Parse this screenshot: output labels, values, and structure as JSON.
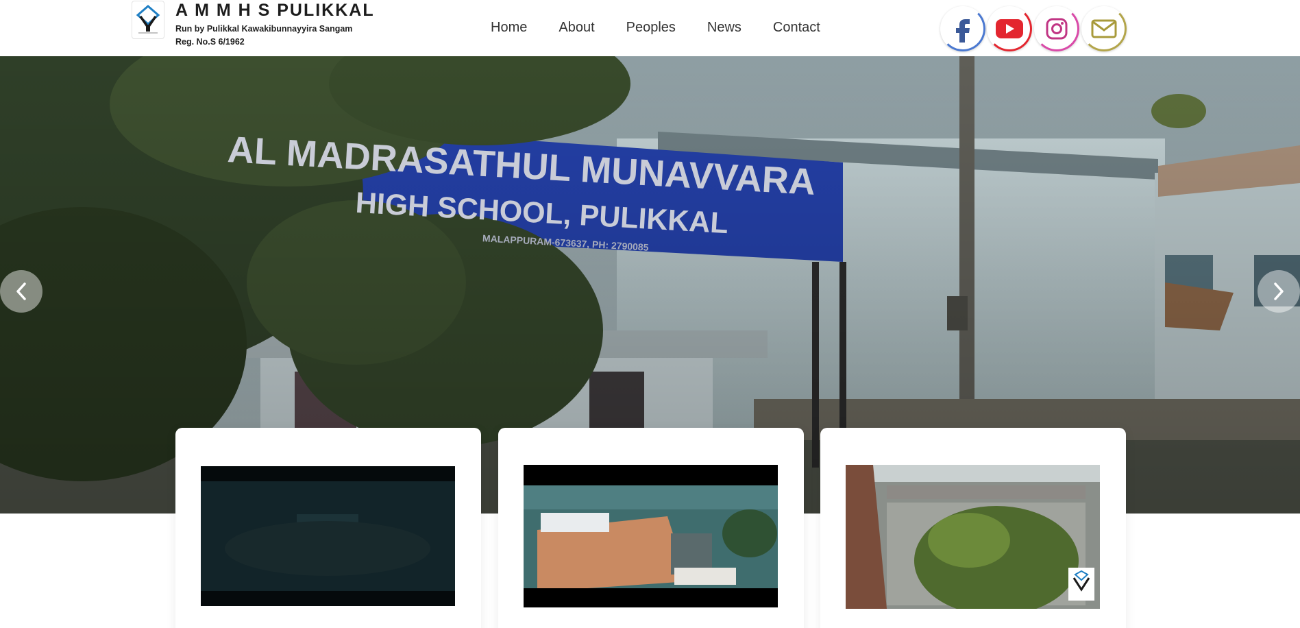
{
  "header": {
    "title": "A M M H S PULIKKAL",
    "subtitle_line1": "Run by Pulikkal Kawakibunnayyira Sangam",
    "subtitle_line2": "Reg. No.S 6/1962",
    "logo_icon": "school-emblem-icon"
  },
  "nav": {
    "items": [
      {
        "label": "Home"
      },
      {
        "label": "About"
      },
      {
        "label": "Peoples"
      },
      {
        "label": "News"
      },
      {
        "label": "Contact"
      }
    ]
  },
  "social": {
    "items": [
      {
        "name": "facebook-icon",
        "color": "#3b5998",
        "ring": "#4a78d0"
      },
      {
        "name": "youtube-icon",
        "color": "#e3262f",
        "ring": "#e3262f"
      },
      {
        "name": "instagram-icon",
        "color": "#c13584",
        "ring": "#d94aa8"
      },
      {
        "name": "mail-icon",
        "color": "#a89a3a",
        "ring": "#b3a54a"
      }
    ]
  },
  "hero": {
    "sign_line1": "AL MADRASATHUL MUNAVVARA",
    "sign_line2": "HIGH SCHOOL, PULIKKAL",
    "sign_line3": "MALAPPURAM-673637, PH: 2790085",
    "prev_icon": "chevron-left-icon",
    "next_icon": "chevron-right-icon"
  },
  "cards": [
    {
      "video_label": "aerial-night-video-thumbnail"
    },
    {
      "video_label": "aerial-campus-video-thumbnail"
    },
    {
      "video_label": "building-tree-video-thumbnail"
    }
  ],
  "colors": {
    "sign_blue": "#2440a8",
    "ground": "#c98a62"
  }
}
